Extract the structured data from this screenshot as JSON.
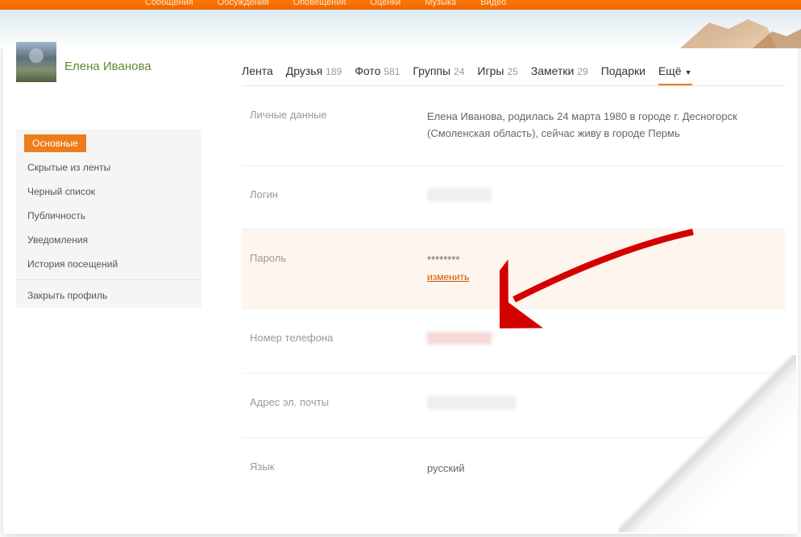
{
  "topNav": [
    "Сообщения",
    "Обсуждения",
    "Оповещения",
    "Оценки",
    "Музыка",
    "Видео"
  ],
  "profile": {
    "name": "Елена Иванова"
  },
  "tabs": [
    {
      "label": "Лента",
      "count": ""
    },
    {
      "label": "Друзья",
      "count": "189"
    },
    {
      "label": "Фото",
      "count": "581"
    },
    {
      "label": "Группы",
      "count": "24"
    },
    {
      "label": "Игры",
      "count": "25"
    },
    {
      "label": "Заметки",
      "count": "29"
    },
    {
      "label": "Подарки",
      "count": ""
    },
    {
      "label": "Ещё",
      "count": ""
    }
  ],
  "sideNav": {
    "items": [
      "Основные",
      "Скрытые из ленты",
      "Черный список",
      "Публичность",
      "Уведомления",
      "История посещений"
    ],
    "close": "Закрыть профиль"
  },
  "settings": {
    "personal": {
      "label": "Личные данные",
      "text": "Елена Иванова, родилась 24 марта 1980 в городе г. Десногорск (Смоленская область), сейчас живу в городе Пермь"
    },
    "login": {
      "label": "Логин"
    },
    "password": {
      "label": "Пароль",
      "masked": "********",
      "change": "изменить"
    },
    "phone": {
      "label": "Номер телефона"
    },
    "email": {
      "label": "Адрес эл. почты"
    },
    "language": {
      "label": "Язык",
      "value": "русский"
    }
  }
}
